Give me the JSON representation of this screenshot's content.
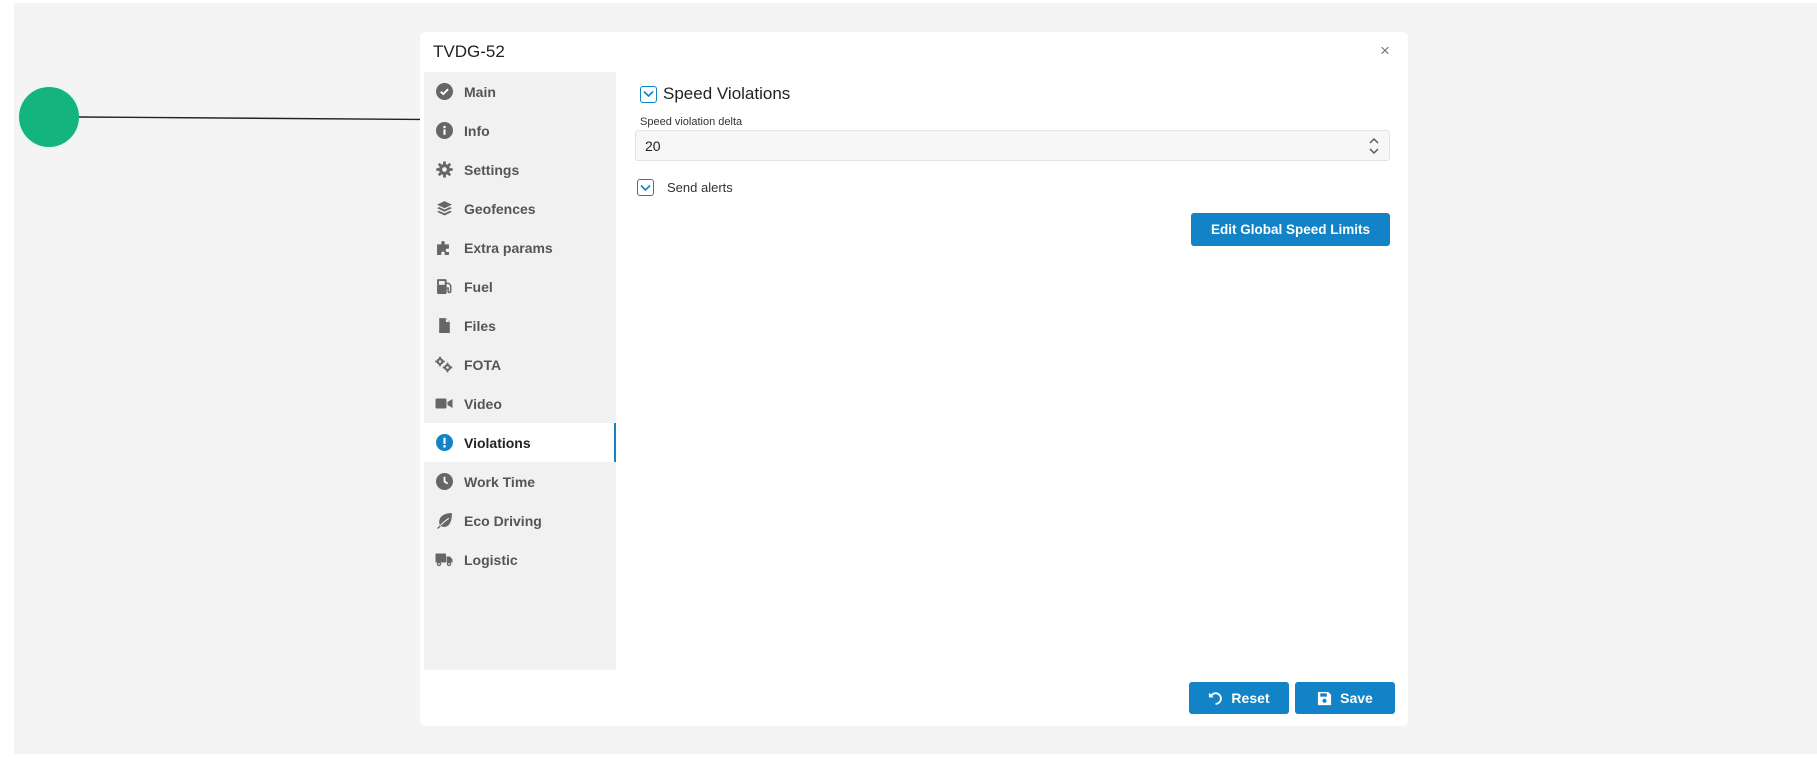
{
  "dialog": {
    "title": "TVDG-52",
    "close_glyph": "×"
  },
  "sidebar": {
    "items": [
      {
        "label": "Main",
        "icon": "check-circle-icon"
      },
      {
        "label": "Info",
        "icon": "info-circle-icon"
      },
      {
        "label": "Settings",
        "icon": "gear-icon"
      },
      {
        "label": "Geofences",
        "icon": "layers-icon"
      },
      {
        "label": "Extra params",
        "icon": "puzzle-icon"
      },
      {
        "label": "Fuel",
        "icon": "fuel-pump-icon"
      },
      {
        "label": "Files",
        "icon": "file-icon"
      },
      {
        "label": "FOTA",
        "icon": "gears-icon"
      },
      {
        "label": "Video",
        "icon": "video-camera-icon"
      },
      {
        "label": "Violations",
        "icon": "exclamation-circle-icon",
        "active": true
      },
      {
        "label": "Work Time",
        "icon": "clock-icon"
      },
      {
        "label": "Eco Driving",
        "icon": "leaf-icon"
      },
      {
        "label": "Logistic",
        "icon": "truck-icon"
      }
    ]
  },
  "content": {
    "section_title": "Speed Violations",
    "section_checked": true,
    "field_label": "Speed violation delta",
    "field_value": "20",
    "send_alerts_label": "Send alerts",
    "send_alerts_checked": true,
    "global_button_label": "Edit Global Speed Limits"
  },
  "footer": {
    "reset_label": "Reset",
    "save_label": "Save"
  },
  "colors": {
    "accent": "#1183c6",
    "marker": "#14b47e"
  }
}
